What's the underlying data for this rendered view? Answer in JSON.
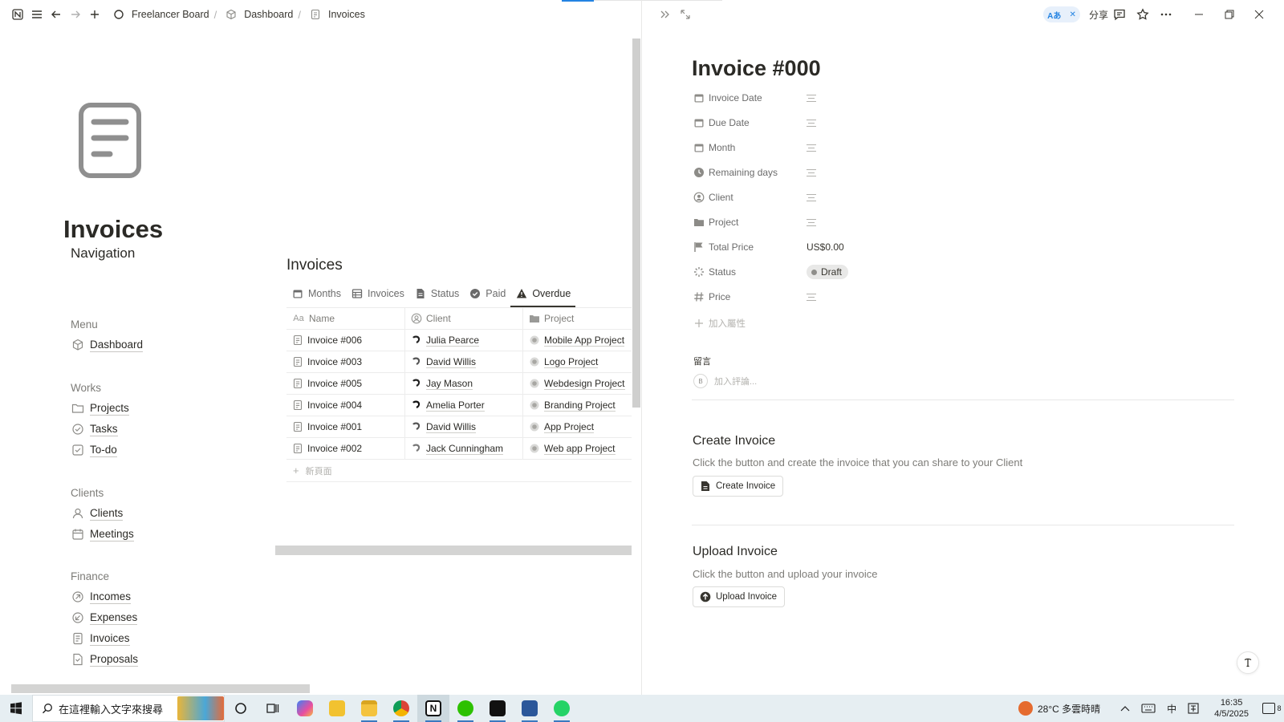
{
  "breadcrumb": {
    "workspace": "Freelancer Board",
    "parent": "Dashboard",
    "current": "Invoices"
  },
  "page": {
    "title": "Invoices"
  },
  "navigation": {
    "title": "Navigation",
    "groups": [
      {
        "label": "Menu",
        "items": [
          {
            "label": "Dashboard",
            "icon": "cube-icon"
          }
        ]
      },
      {
        "label": "Works",
        "items": [
          {
            "label": "Projects",
            "icon": "folder-icon"
          },
          {
            "label": "Tasks",
            "icon": "check-circle-icon"
          },
          {
            "label": "To-do",
            "icon": "checkbox-icon"
          }
        ]
      },
      {
        "label": "Clients",
        "items": [
          {
            "label": "Clients",
            "icon": "person-icon"
          },
          {
            "label": "Meetings",
            "icon": "calendar-icon"
          }
        ]
      },
      {
        "label": "Finance",
        "items": [
          {
            "label": "Incomes",
            "icon": "arrow-circle-icon"
          },
          {
            "label": "Expenses",
            "icon": "arrow-circle-icon"
          },
          {
            "label": "Invoices",
            "icon": "document-icon"
          },
          {
            "label": "Proposals",
            "icon": "document-icon"
          }
        ]
      }
    ]
  },
  "database": {
    "title": "Invoices",
    "tabs": [
      {
        "label": "Months",
        "icon": "calendar-icon"
      },
      {
        "label": "Invoices",
        "icon": "table-icon"
      },
      {
        "label": "Status",
        "icon": "document-icon"
      },
      {
        "label": "Paid",
        "icon": "check-circle-icon"
      },
      {
        "label": "Overdue",
        "icon": "warning-icon",
        "active": true
      }
    ],
    "columns": {
      "name": "Name",
      "client": "Client",
      "project": "Project",
      "name_icon": "Aa"
    },
    "rows": [
      {
        "name": "Invoice #006",
        "client": "Julia Pearce",
        "project": "Mobile App Project"
      },
      {
        "name": "Invoice #003",
        "client": "David Willis",
        "project": "Logo Project"
      },
      {
        "name": "Invoice #005",
        "client": "Jay Mason",
        "project": "Webdesign Project"
      },
      {
        "name": "Invoice #004",
        "client": "Amelia Porter",
        "project": "Branding Project"
      },
      {
        "name": "Invoice #001",
        "client": "David Willis",
        "project": "App Project"
      },
      {
        "name": "Invoice #002",
        "client": "Jack Cunningham",
        "project": "Web app Project"
      }
    ],
    "new_page": "新頁面"
  },
  "panel": {
    "translate_chip": "Aあ",
    "share_label": "分享",
    "title": "Invoice #000",
    "properties": [
      {
        "name": "Invoice Date",
        "icon": "calendar-icon",
        "value": ""
      },
      {
        "name": "Due Date",
        "icon": "calendar-icon",
        "value": ""
      },
      {
        "name": "Month",
        "icon": "calendar-icon",
        "value": ""
      },
      {
        "name": "Remaining days",
        "icon": "clock-icon",
        "value": ""
      },
      {
        "name": "Client",
        "icon": "person-circle-icon",
        "value": ""
      },
      {
        "name": "Project",
        "icon": "folder-icon",
        "value": ""
      },
      {
        "name": "Total Price",
        "icon": "flag-icon",
        "value": "US$0.00"
      },
      {
        "name": "Status",
        "icon": "status-icon",
        "value": "Draft"
      },
      {
        "name": "Price",
        "icon": "hash-icon",
        "value": ""
      }
    ],
    "add_property": "加入屬性",
    "comments_label": "留言",
    "comment_avatar": "B",
    "comment_placeholder": "加入評論...",
    "create_section": {
      "title": "Create Invoice",
      "desc": "Click the button and create the invoice that you can share to your Client",
      "button": "Create Invoice"
    },
    "upload_section": {
      "title": "Upload Invoice",
      "desc": "Click the button and upload your invoice",
      "button": "Upload Invoice"
    }
  },
  "taskbar": {
    "search_placeholder": "在這裡輸入文字來搜尋",
    "weather": "28°C 多雲時晴",
    "ime": "中",
    "time": "16:35",
    "date": "4/5/2025",
    "notifications": "8"
  }
}
